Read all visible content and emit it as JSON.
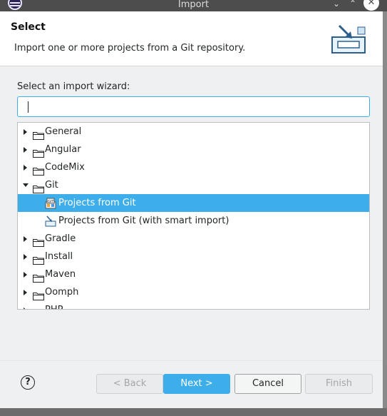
{
  "window": {
    "title": "Import"
  },
  "header": {
    "title": "Select",
    "description": "Import one or more projects from a Git repository."
  },
  "filter": {
    "label": "Select an import wizard:",
    "value": ""
  },
  "tree": {
    "items": [
      {
        "label": "General",
        "expanded": false
      },
      {
        "label": "Angular",
        "expanded": false
      },
      {
        "label": "CodeMix",
        "expanded": false
      },
      {
        "label": "Git",
        "expanded": true
      },
      {
        "label": "Projects from Git",
        "child": true,
        "selected": true,
        "icon": "git-repo-icon"
      },
      {
        "label": "Projects from Git (with smart import)",
        "child": true,
        "icon": "smart-import-icon"
      },
      {
        "label": "Gradle",
        "expanded": false
      },
      {
        "label": "Install",
        "expanded": false
      },
      {
        "label": "Maven",
        "expanded": false
      },
      {
        "label": "Oomph",
        "expanded": false
      },
      {
        "label": "PHP",
        "expanded": false
      }
    ]
  },
  "buttons": {
    "help": "?",
    "back": "< Back",
    "next": "Next >",
    "cancel": "Cancel",
    "finish": "Finish"
  },
  "colors": {
    "accent": "#3daee9",
    "dialog_bg": "#eff0f1",
    "titlebar": "#4d4d4d"
  }
}
